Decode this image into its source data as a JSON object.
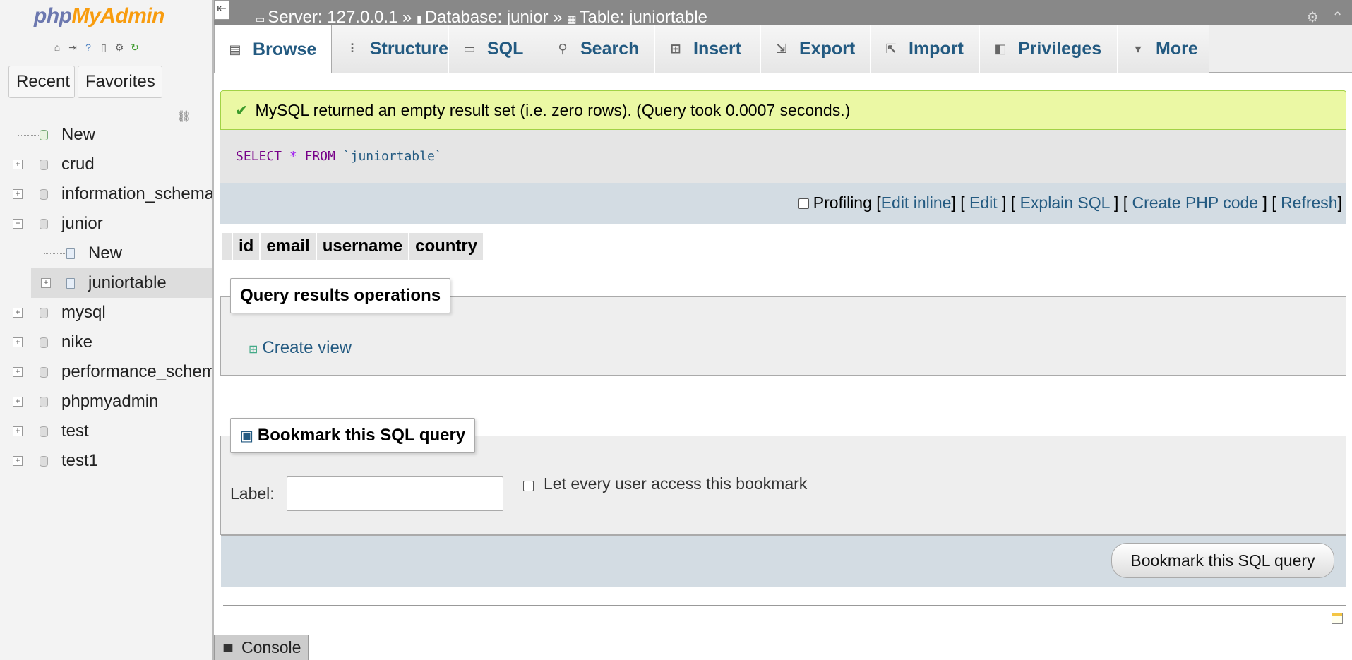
{
  "logo": {
    "php": "php",
    "myadmin": "MyAdmin"
  },
  "nav": {
    "tabs": {
      "recent": "Recent",
      "favorites": "Favorites"
    },
    "tree": {
      "new": "New",
      "crud": "crud",
      "information_schema": "information_schema",
      "junior": "junior",
      "junior_new": "New",
      "juniortable": "juniortable",
      "mysql": "mysql",
      "nike": "nike",
      "performance_schema": "performance_schema",
      "phpmyadmin": "phpmyadmin",
      "test": "test",
      "test1": "test1"
    }
  },
  "breadcrumb": {
    "server": "Server: 127.0.0.1",
    "sep1": " » ",
    "database": "Database: junior",
    "sep2": " » ",
    "table": "Table: juniortable"
  },
  "tabs": {
    "browse": "Browse",
    "structure": "Structure",
    "sql": "SQL",
    "search": "Search",
    "insert": "Insert",
    "export": "Export",
    "import": "Import",
    "privileges": "Privileges",
    "more": "More"
  },
  "message": "MySQL returned an empty result set (i.e. zero rows). (Query took 0.0007 seconds.)",
  "sql": {
    "select": "SELECT",
    "star": "*",
    "from": "FROM",
    "table": "`juniortable`"
  },
  "sqlbar": {
    "profiling": "Profiling",
    "edit_inline": "Edit inline",
    "edit": "Edit",
    "explain": "Explain SQL",
    "php": "Create PHP code",
    "refresh": "Refresh"
  },
  "columns": [
    "id",
    "email",
    "username",
    "country"
  ],
  "ops": {
    "legend": "Query results operations",
    "create_view": "Create view"
  },
  "bookmark": {
    "legend": "Bookmark this SQL query",
    "label": "Label:",
    "label_value": "",
    "share": "Let every user access this bookmark",
    "button": "Bookmark this SQL query"
  },
  "console": "Console"
}
